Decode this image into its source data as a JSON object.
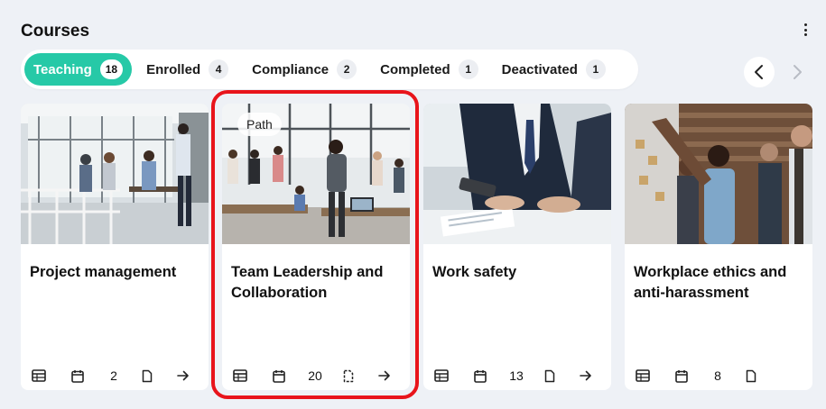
{
  "header": {
    "title": "Courses",
    "menu_icon": "kebab-menu-icon"
  },
  "tabs": [
    {
      "label": "Teaching",
      "count": "18",
      "active": true
    },
    {
      "label": "Enrolled",
      "count": "4",
      "active": false
    },
    {
      "label": "Compliance",
      "count": "2",
      "active": false
    },
    {
      "label": "Completed",
      "count": "1",
      "active": false
    },
    {
      "label": "Deactivated",
      "count": "1",
      "active": false
    }
  ],
  "nav": {
    "prev_icon": "chevron-left-icon",
    "next_icon": "chevron-right-icon",
    "next_disabled": true
  },
  "colors": {
    "accent": "#26c9a7",
    "highlight": "#e8141b",
    "background": "#eef1f6"
  },
  "cards": [
    {
      "title": "Project management",
      "count": "2",
      "badge": "",
      "footer_icons": [
        "table-icon",
        "calendar-icon",
        "document-icon",
        "arrow-right-icon"
      ]
    },
    {
      "title": "Team Leadership and Collaboration",
      "count": "20",
      "badge": "Path",
      "footer_icons": [
        "table-icon",
        "calendar-icon",
        "dashed-document-icon",
        "arrow-right-icon"
      ]
    },
    {
      "title": "Work safety",
      "count": "13",
      "badge": "",
      "footer_icons": [
        "table-icon",
        "calendar-icon",
        "document-icon",
        "arrow-right-icon"
      ]
    },
    {
      "title": "Workplace ethics and anti-harassment",
      "count": "8",
      "badge": "",
      "footer_icons": [
        "table-icon",
        "calendar-icon",
        "document-icon"
      ]
    }
  ]
}
